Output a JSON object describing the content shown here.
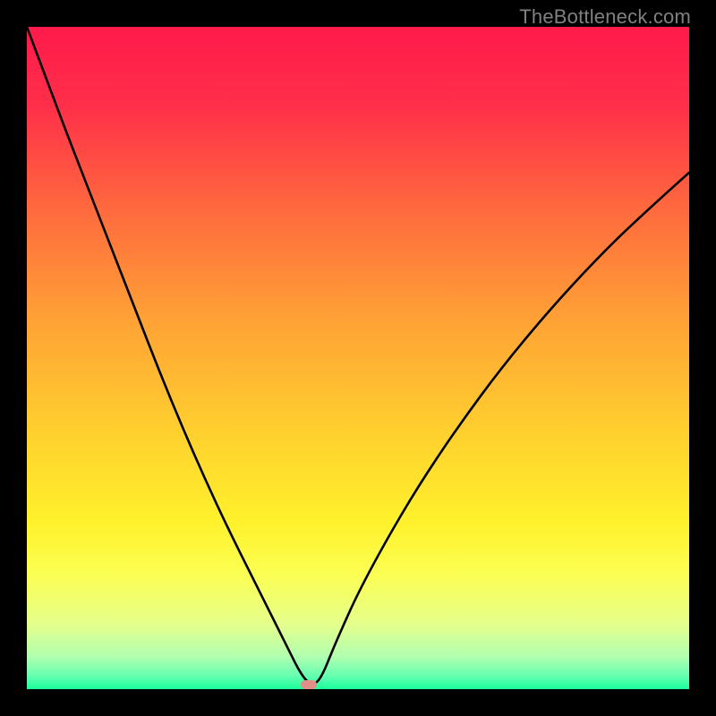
{
  "watermark": "TheBottleneck.com",
  "marker": {
    "x_pct": 42.5,
    "y_pct": 99.3,
    "color": "#e48e8a"
  },
  "gradient_stops": [
    {
      "pct": 0,
      "color": "#ff1a4b"
    },
    {
      "pct": 12,
      "color": "#ff2f49"
    },
    {
      "pct": 28,
      "color": "#ff6b3e"
    },
    {
      "pct": 45,
      "color": "#ffa435"
    },
    {
      "pct": 62,
      "color": "#ffd22e"
    },
    {
      "pct": 75,
      "color": "#fff22c"
    },
    {
      "pct": 83,
      "color": "#fbff55"
    },
    {
      "pct": 90,
      "color": "#e6ff8a"
    },
    {
      "pct": 95,
      "color": "#b3ffb0"
    },
    {
      "pct": 98,
      "color": "#66ffb0"
    },
    {
      "pct": 100,
      "color": "#1aff9e"
    }
  ],
  "curve_points_pct": [
    [
      0.0,
      0.0
    ],
    [
      3.0,
      8.0
    ],
    [
      6.0,
      16.0
    ],
    [
      9.5,
      25.0
    ],
    [
      13.0,
      34.0
    ],
    [
      16.5,
      43.0
    ],
    [
      20.0,
      52.0
    ],
    [
      23.5,
      60.5
    ],
    [
      27.0,
      68.5
    ],
    [
      30.5,
      76.0
    ],
    [
      34.0,
      83.0
    ],
    [
      36.5,
      88.0
    ],
    [
      38.5,
      92.0
    ],
    [
      40.0,
      95.0
    ],
    [
      41.0,
      97.0
    ],
    [
      42.0,
      98.5
    ],
    [
      42.8,
      99.2
    ],
    [
      43.5,
      99.2
    ],
    [
      44.2,
      98.5
    ],
    [
      45.0,
      97.0
    ],
    [
      46.0,
      94.5
    ],
    [
      47.5,
      91.0
    ],
    [
      50.0,
      85.5
    ],
    [
      54.0,
      78.0
    ],
    [
      59.0,
      69.5
    ],
    [
      65.0,
      60.5
    ],
    [
      72.0,
      51.0
    ],
    [
      80.0,
      41.5
    ],
    [
      88.0,
      33.0
    ],
    [
      95.0,
      26.5
    ],
    [
      100.0,
      22.0
    ]
  ],
  "chart_data": {
    "type": "line",
    "title": "",
    "xlabel": "",
    "ylabel": "",
    "x_range_pct": [
      0,
      100
    ],
    "y_range_pct": [
      0,
      100
    ],
    "note": "x/y given as percentages of plot area; y=0 at top, y=100 at bottom (bottom = best / green).",
    "series": [
      {
        "name": "bottleneck-curve",
        "points_pct": [
          [
            0.0,
            0.0
          ],
          [
            3.0,
            8.0
          ],
          [
            6.0,
            16.0
          ],
          [
            9.5,
            25.0
          ],
          [
            13.0,
            34.0
          ],
          [
            16.5,
            43.0
          ],
          [
            20.0,
            52.0
          ],
          [
            23.5,
            60.5
          ],
          [
            27.0,
            68.5
          ],
          [
            30.5,
            76.0
          ],
          [
            34.0,
            83.0
          ],
          [
            36.5,
            88.0
          ],
          [
            38.5,
            92.0
          ],
          [
            40.0,
            95.0
          ],
          [
            41.0,
            97.0
          ],
          [
            42.0,
            98.5
          ],
          [
            42.8,
            99.2
          ],
          [
            43.5,
            99.2
          ],
          [
            44.2,
            98.5
          ],
          [
            45.0,
            97.0
          ],
          [
            46.0,
            94.5
          ],
          [
            47.5,
            91.0
          ],
          [
            50.0,
            85.5
          ],
          [
            54.0,
            78.0
          ],
          [
            59.0,
            69.5
          ],
          [
            65.0,
            60.5
          ],
          [
            72.0,
            51.0
          ],
          [
            80.0,
            41.5
          ],
          [
            88.0,
            33.0
          ],
          [
            95.0,
            26.5
          ],
          [
            100.0,
            22.0
          ]
        ]
      }
    ],
    "optimal_marker_pct": {
      "x": 42.5,
      "y": 99.3
    },
    "background_gradient": "vertical red→orange→yellow→green (top→bottom)"
  }
}
